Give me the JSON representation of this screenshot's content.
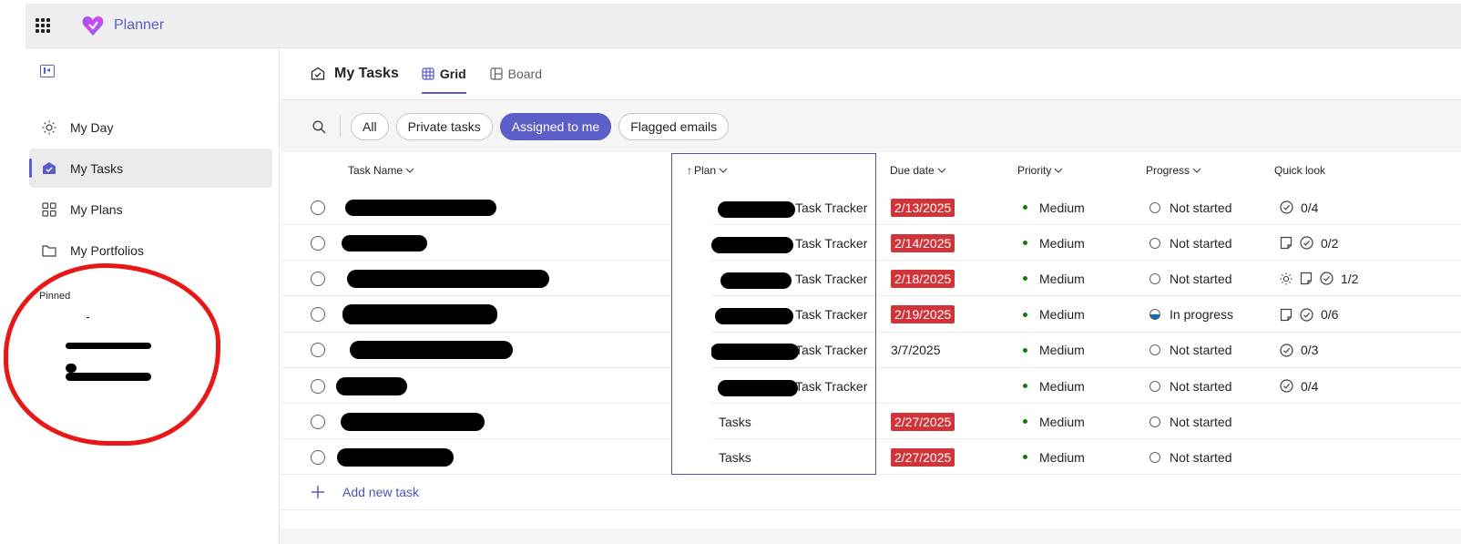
{
  "app": {
    "name": "Planner"
  },
  "sidebar": {
    "items": [
      {
        "label": "My Day",
        "icon": "sun-icon"
      },
      {
        "label": "My Tasks",
        "icon": "my-tasks-icon",
        "active": true
      },
      {
        "label": "My Plans",
        "icon": "grid-plans-icon"
      },
      {
        "label": "My Portfolios",
        "icon": "folder-icon"
      }
    ],
    "pinned_label": "Pinned"
  },
  "header": {
    "title": "My Tasks",
    "tabs": [
      {
        "label": "Grid",
        "active": true
      },
      {
        "label": "Board",
        "active": false
      }
    ]
  },
  "filters": [
    {
      "label": "All",
      "active": false
    },
    {
      "label": "Private tasks",
      "active": false
    },
    {
      "label": "Assigned to me",
      "active": true
    },
    {
      "label": "Flagged emails",
      "active": false
    }
  ],
  "columns": {
    "task_name": "Task Name",
    "plan": "Plan",
    "due_date": "Due date",
    "priority": "Priority",
    "progress": "Progress",
    "quick_look": "Quick look"
  },
  "rows": [
    {
      "plan": "Task Tracker",
      "due": "2/13/2025",
      "late": true,
      "priority": "Medium",
      "progress": "Not started",
      "ql_icons": [
        "checklist"
      ],
      "checklist": "0/4"
    },
    {
      "plan": "Task Tracker",
      "due": "2/14/2025",
      "late": true,
      "priority": "Medium",
      "progress": "Not started",
      "ql_icons": [
        "note",
        "checklist"
      ],
      "checklist": "0/2"
    },
    {
      "plan": "Task Tracker",
      "due": "2/18/2025",
      "late": true,
      "priority": "Medium",
      "progress": "Not started",
      "ql_icons": [
        "sun",
        "note",
        "checklist"
      ],
      "checklist": "1/2"
    },
    {
      "plan": "Task Tracker",
      "due": "2/19/2025",
      "late": true,
      "priority": "Medium",
      "progress": "In progress",
      "ql_icons": [
        "note",
        "checklist"
      ],
      "checklist": "0/6"
    },
    {
      "plan": "Task Tracker",
      "due": "3/7/2025",
      "late": false,
      "priority": "Medium",
      "progress": "Not started",
      "ql_icons": [
        "checklist"
      ],
      "checklist": "0/3"
    },
    {
      "plan": "Task Tracker",
      "due": "",
      "late": false,
      "priority": "Medium",
      "progress": "Not started",
      "ql_icons": [
        "checklist"
      ],
      "checklist": "0/4"
    },
    {
      "plan": "Tasks",
      "due": "2/27/2025",
      "late": true,
      "priority": "Medium",
      "progress": "Not started",
      "ql_icons": [],
      "checklist": ""
    },
    {
      "plan": "Tasks",
      "due": "2/27/2025",
      "late": true,
      "priority": "Medium",
      "progress": "Not started",
      "ql_icons": [],
      "checklist": ""
    }
  ],
  "add_task_label": "Add new task",
  "colors": {
    "accent": "#5b5fc7",
    "late": "#d13438",
    "priority_dot": "#107c10",
    "annotation": "#e81818"
  }
}
